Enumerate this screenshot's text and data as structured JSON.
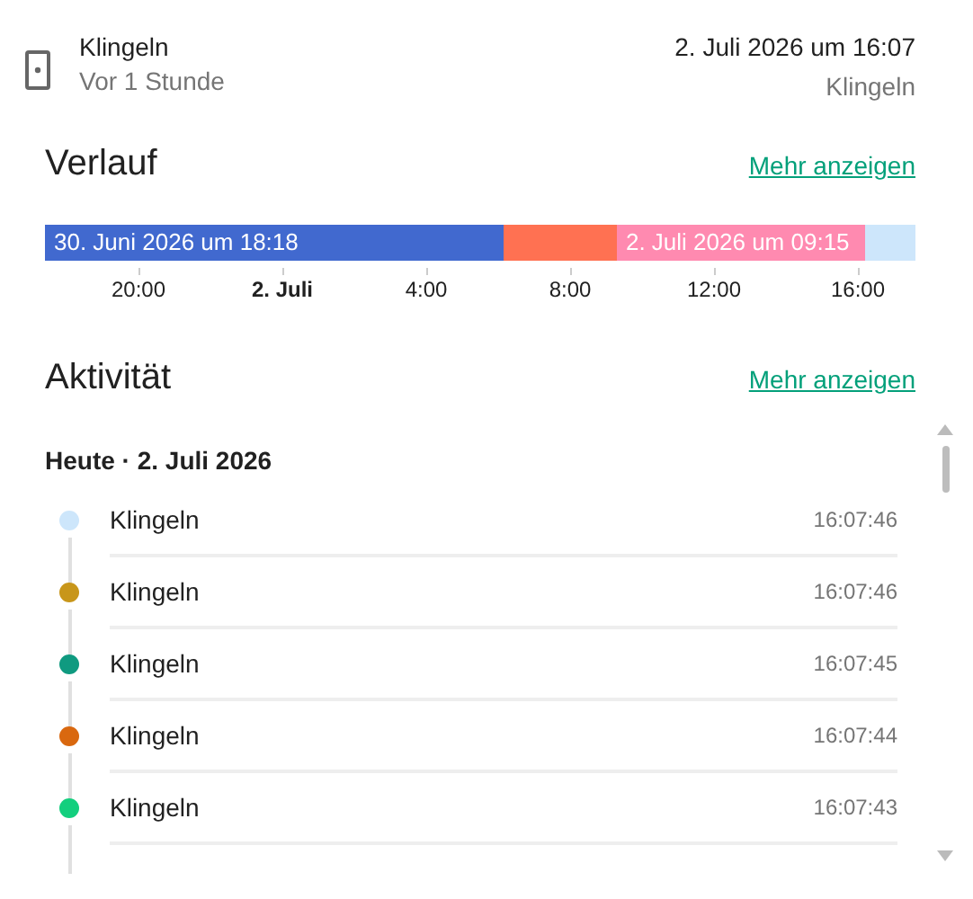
{
  "header": {
    "title": "Klingeln",
    "subtitle": "Vor 1 Stunde",
    "timestamp": "2. Juli 2026 um 16:07",
    "state": "Klingeln"
  },
  "history": {
    "title": "Verlauf",
    "more_link": "Mehr anzeigen",
    "segments": [
      {
        "label": "30. Juni 2026 um 18:18",
        "color": "#4169cf"
      },
      {
        "color": "#ff7152"
      },
      {
        "label": "2. Juli 2026 um 09:15",
        "color": "#ff8ab0"
      },
      {
        "color": "#cde6fb"
      }
    ],
    "ticks": [
      {
        "label": "20:00",
        "bold": false
      },
      {
        "label": "2. Juli",
        "bold": true
      },
      {
        "label": "4:00",
        "bold": false
      },
      {
        "label": "8:00",
        "bold": false
      },
      {
        "label": "12:00",
        "bold": false
      },
      {
        "label": "16:00",
        "bold": false
      }
    ]
  },
  "activity": {
    "title": "Aktivität",
    "more_link": "Mehr anzeigen",
    "day_heading": "Heute · 2. Juli 2026",
    "entries": [
      {
        "label": "Klingeln",
        "time": "16:07:46",
        "color": "#cde6fb"
      },
      {
        "label": "Klingeln",
        "time": "16:07:46",
        "color": "#c8961a"
      },
      {
        "label": "Klingeln",
        "time": "16:07:45",
        "color": "#0f9a80"
      },
      {
        "label": "Klingeln",
        "time": "16:07:44",
        "color": "#d9680f"
      },
      {
        "label": "Klingeln",
        "time": "16:07:43",
        "color": "#13cf7e"
      }
    ]
  }
}
